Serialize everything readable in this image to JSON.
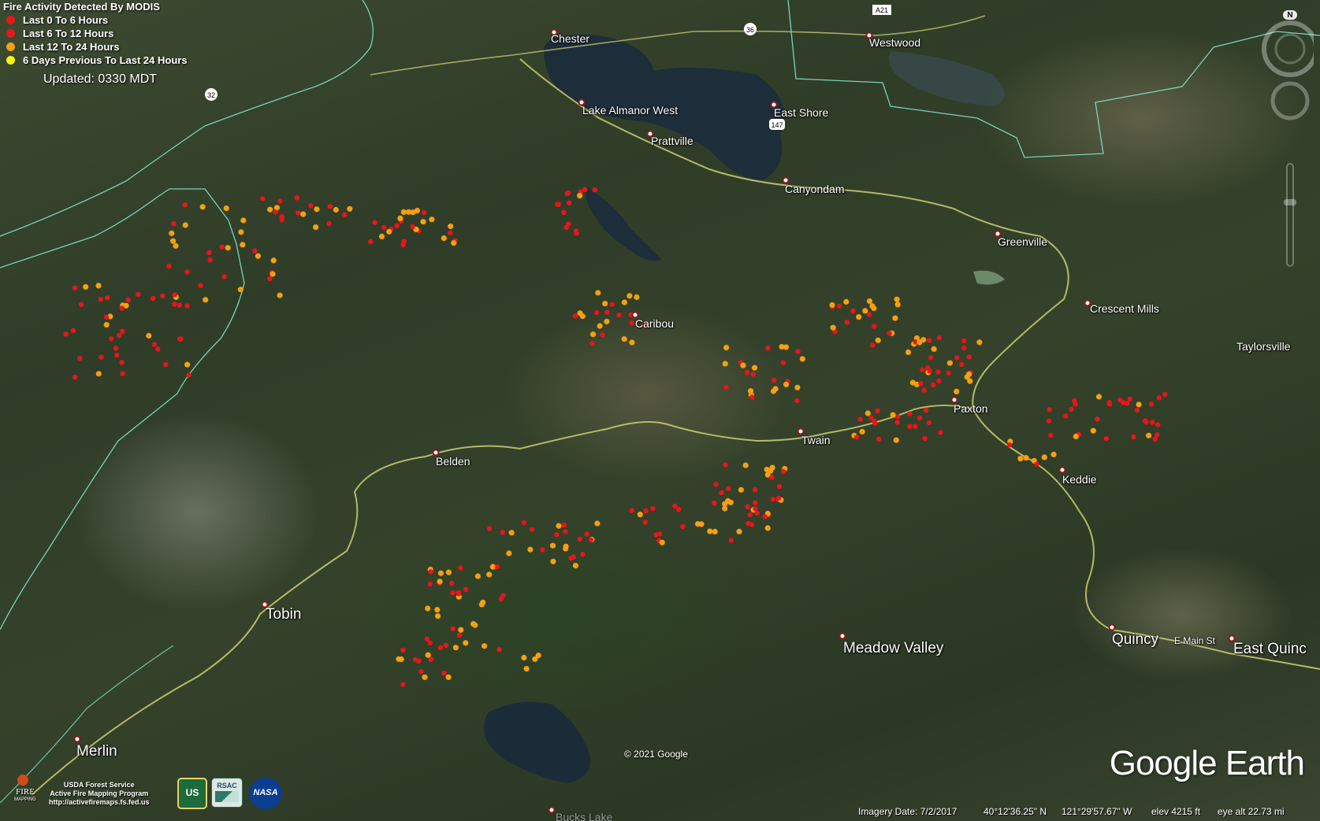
{
  "legend": {
    "title": "Fire Activity Detected By MODIS",
    "items": [
      {
        "label": "Last 0 To 6 Hours",
        "color": "#e8151b"
      },
      {
        "label": "Last 6 To 12 Hours",
        "color": "#e8151b"
      },
      {
        "label": "Last 12 To 24 Hours",
        "color": "#f5a00d"
      },
      {
        "label": "6 Days Previous To Last 24 Hours",
        "color": "#f7f30a"
      }
    ],
    "updated": "Updated: 0330 MDT"
  },
  "places": {
    "chester": "Chester",
    "westwood": "Westwood",
    "lake_almanor_west": "Lake Almanor West",
    "prattville": "Prattville",
    "east_shore": "East Shore",
    "canyondam": "Canyondam",
    "greenville": "Greenville",
    "crescent_mills": "Crescent Mills",
    "taylorsville": "Taylorsville",
    "caribou": "Caribou",
    "paxton": "Paxton",
    "twain": "Twain",
    "keddie": "Keddie",
    "belden": "Belden",
    "tobin": "Tobin",
    "meadow_valley": "Meadow Valley",
    "quincy": "Quincy",
    "e_main_st": "E Main St",
    "east_quincy": "East Quinc",
    "merlin": "Merlin",
    "bucks_lake": "Bucks Lake"
  },
  "shields": {
    "r32": "32",
    "r36": "36",
    "r147": "147",
    "a21": "A21"
  },
  "credits": {
    "line1": "USDA Forest Service",
    "line2": "Active Fire Mapping Program",
    "line3": "http://activefiremaps.fs.fed.us",
    "fire_logo": "FIRE",
    "fire_logo_sub": "MAPPING",
    "usfs_logo": "US",
    "rsac_logo": "RSAC",
    "nasa_logo": "NASA"
  },
  "brand": "Google Earth",
  "copyright": "© 2021 Google",
  "status": {
    "imagery_date": "Imagery Date: 7/2/2017",
    "lat": "40°12'36.25\" N",
    "lon": "121°29'57.67\" W",
    "elev": "elev  4215 ft",
    "eye_alt": "eye alt  22.73 mi"
  },
  "compass": {
    "north": "N"
  }
}
